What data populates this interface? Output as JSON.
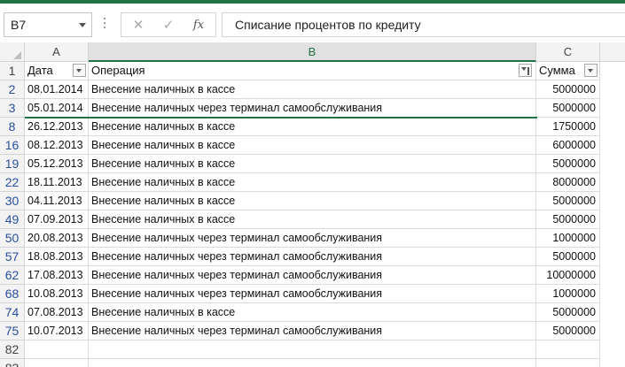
{
  "formula_bar": {
    "name_box": "B7",
    "cancel_glyph": "✕",
    "enter_glyph": "✓",
    "fx_label": "fx",
    "content": "Списание процентов по кредиту"
  },
  "columns": [
    "A",
    "B",
    "C"
  ],
  "header_row": {
    "row_number": "1",
    "date_label": "Дата",
    "operation_label": "Операция",
    "amount_label": "Сумма"
  },
  "rows": [
    {
      "n": "2",
      "date": "08.01.2014",
      "op": "Внесение наличных в кассе",
      "amount": "5000000"
    },
    {
      "n": "3",
      "date": "05.01.2014",
      "op": "Внесение наличных через терминал самообслуживания",
      "amount": "5000000"
    },
    {
      "n": "8",
      "date": "26.12.2013",
      "op": "Внесение наличных в кассе",
      "amount": "1750000"
    },
    {
      "n": "16",
      "date": "08.12.2013",
      "op": "Внесение наличных в кассе",
      "amount": "6000000"
    },
    {
      "n": "19",
      "date": "05.12.2013",
      "op": "Внесение наличных в кассе",
      "amount": "5000000"
    },
    {
      "n": "22",
      "date": "18.11.2013",
      "op": "Внесение наличных в кассе",
      "amount": "8000000"
    },
    {
      "n": "30",
      "date": "04.11.2013",
      "op": "Внесение наличных в кассе",
      "amount": "5000000"
    },
    {
      "n": "49",
      "date": "07.09.2013",
      "op": "Внесение наличных в кассе",
      "amount": "5000000"
    },
    {
      "n": "50",
      "date": "20.08.2013",
      "op": "Внесение наличных через терминал самообслуживания",
      "amount": "1000000"
    },
    {
      "n": "57",
      "date": "18.08.2013",
      "op": "Внесение наличных через терминал самообслуживания",
      "amount": "5000000"
    },
    {
      "n": "62",
      "date": "17.08.2013",
      "op": "Внесение наличных через терминал самообслуживания",
      "amount": "10000000"
    },
    {
      "n": "68",
      "date": "10.08.2013",
      "op": "Внесение наличных через терминал самообслуживания",
      "amount": "1000000"
    },
    {
      "n": "74",
      "date": "07.08.2013",
      "op": "Внесение наличных в кассе",
      "amount": "5000000"
    },
    {
      "n": "75",
      "date": "10.07.2013",
      "op": "Внесение наличных через терминал самообслуживания",
      "amount": "5000000"
    }
  ],
  "empty_rows": [
    "82",
    "83"
  ],
  "colors": {
    "accent": "#217346",
    "row_number_filtered": "#2a4f9e"
  }
}
